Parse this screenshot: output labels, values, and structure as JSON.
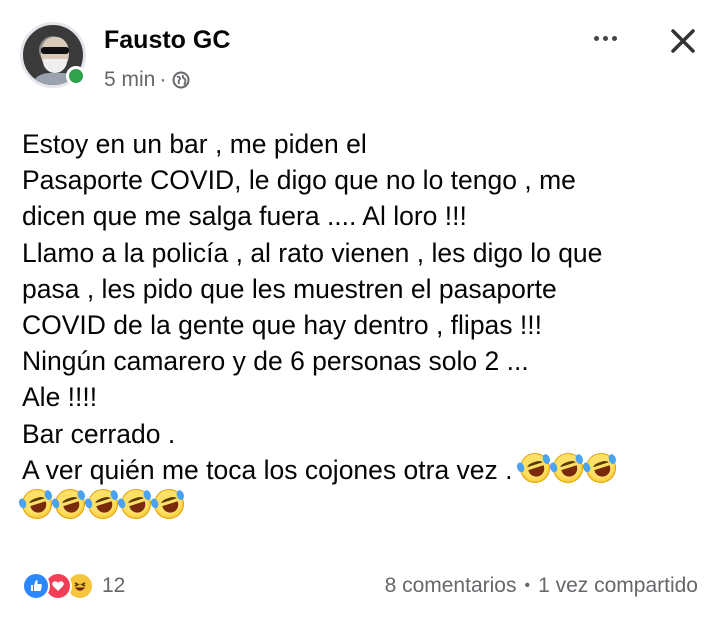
{
  "author": {
    "name": "Fausto GC",
    "time": "5 min",
    "separator": "·",
    "privacy_icon": "globe-icon",
    "online": true
  },
  "header_actions": {
    "more_icon": "more-horizontal-icon",
    "close_icon": "close-icon"
  },
  "post": {
    "lines": [
      "Estoy en un bar , me piden el",
      "Pasaporte COVID, le digo que no lo tengo , me",
      "dicen que me salga fuera .... Al loro !!!",
      "Llamo a la policía , al rato vienen , les digo lo que",
      "pasa , les pido que les muestren el pasaporte",
      "COVID de la gente que hay dentro , flipas !!!",
      "Ningún camarero y de 6 personas solo 2 ...",
      "Ale !!!!",
      "Bar cerrado .",
      "A ver quién me toca los cojones otra vez ."
    ],
    "trailing_emoji": "face-with-tears-of-joy",
    "trailing_emoji_count_line10": 3,
    "emoji_line_count": 5
  },
  "footer": {
    "reactions": [
      "like-icon",
      "love-icon",
      "haha-icon"
    ],
    "reaction_count": "12",
    "comments": "8 comentarios",
    "separator": "•",
    "shares": "1 vez compartido"
  },
  "colors": {
    "text": "#050505",
    "secondary": "#65676b",
    "online": "#31a24c",
    "like": "#2d88ff",
    "love": "#f33e58",
    "haha": "#f7c53b"
  }
}
